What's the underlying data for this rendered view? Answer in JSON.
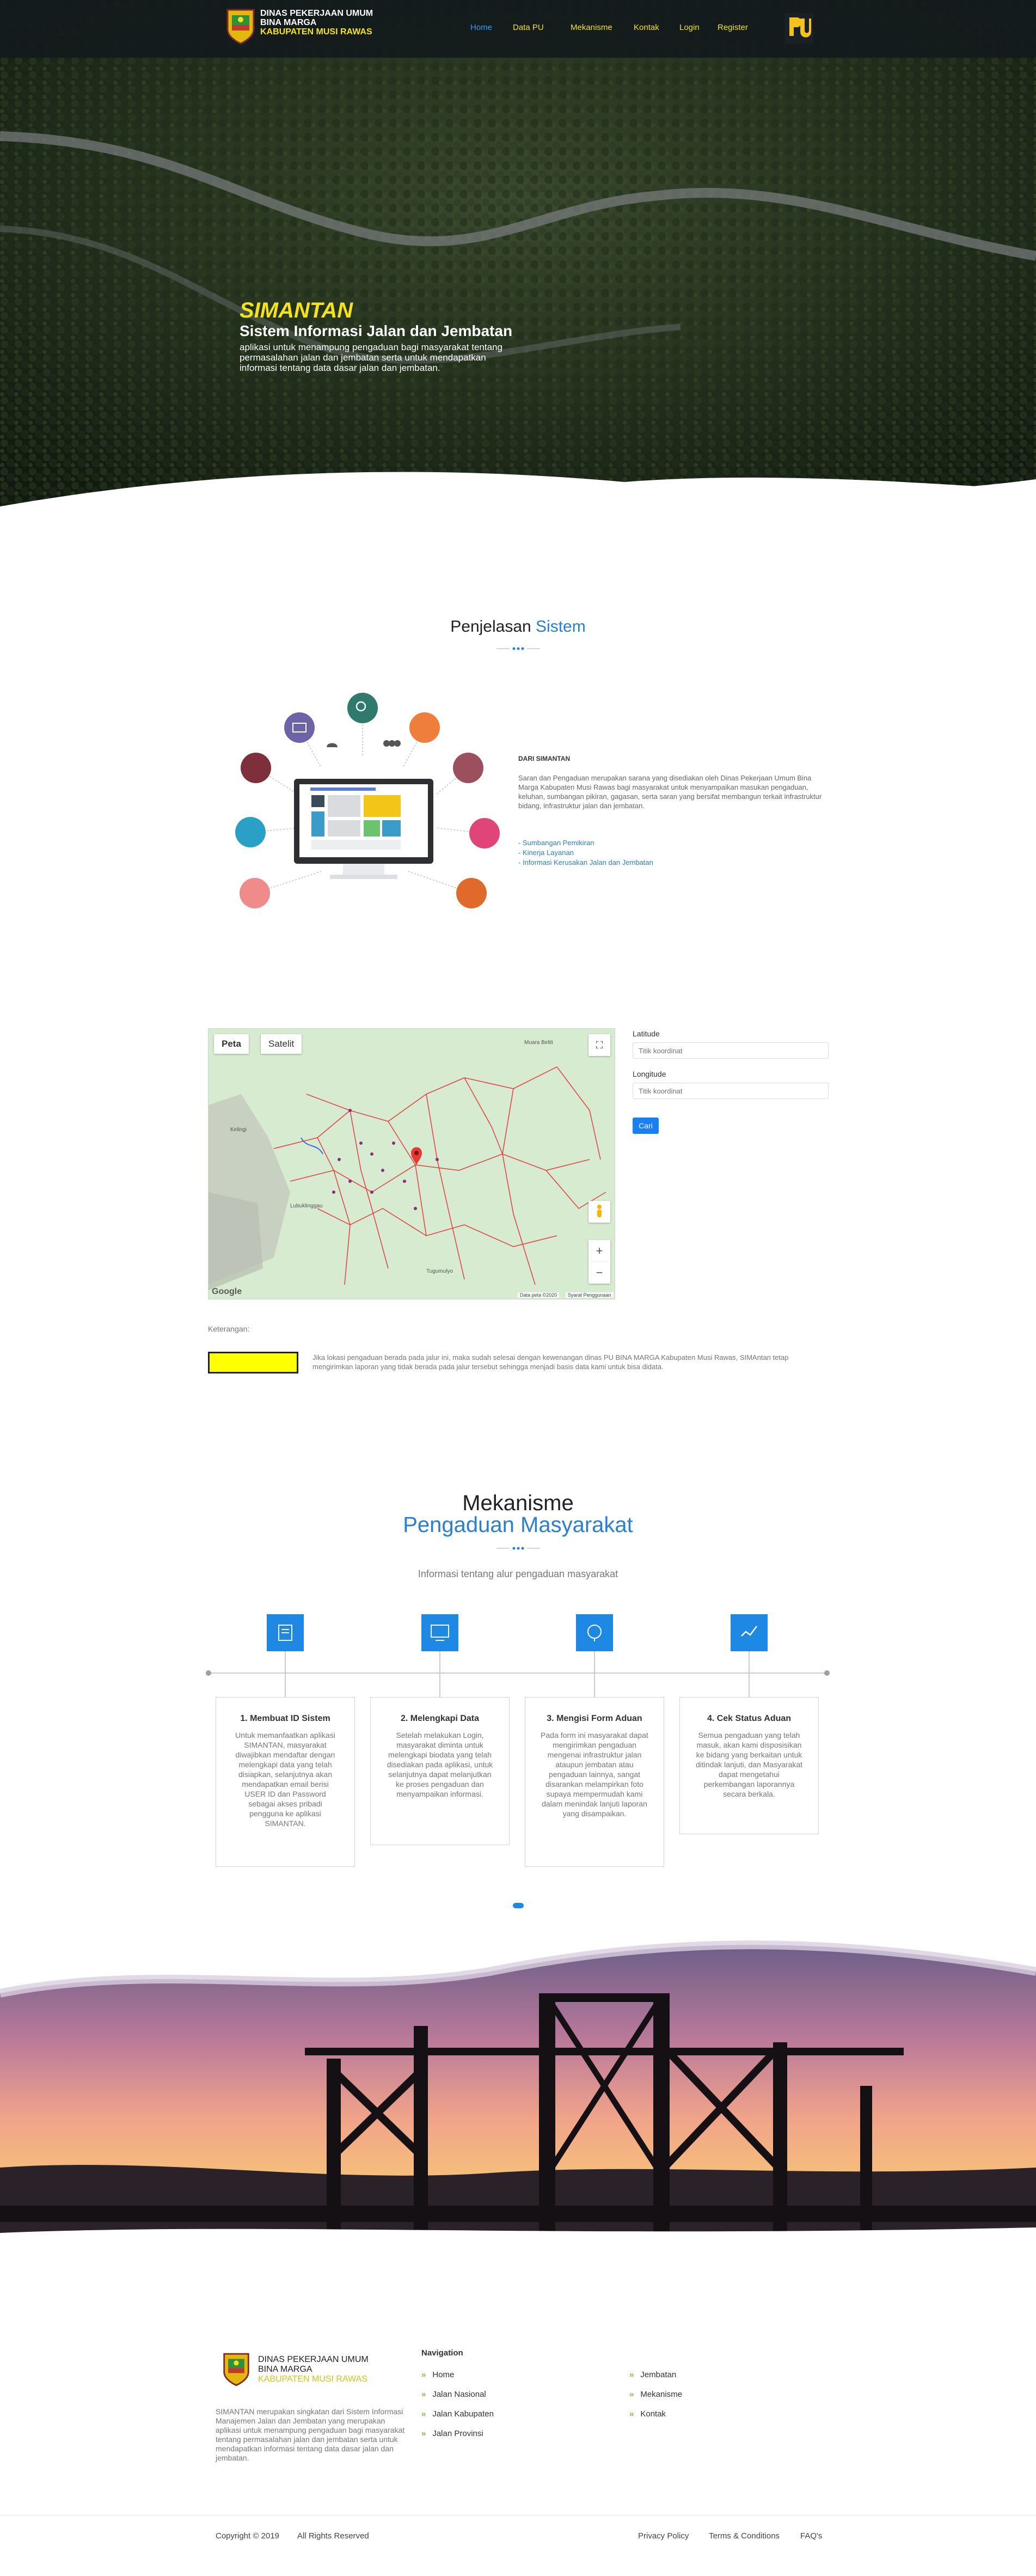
{
  "header": {
    "org_line1": "DINAS PEKERJAAN UMUM",
    "org_line2": "BINA MARGA",
    "org_line3": "KABUPATEN MUSI RAWAS",
    "nav": [
      "Home",
      "Data PU",
      "Mekanisme",
      "Kontak",
      "Login",
      "Register"
    ],
    "active_nav": "Home"
  },
  "hero": {
    "title": "SIMANTAN",
    "subtitle": "Sistem Informasi Jalan dan Jembatan",
    "description": "aplikasi untuk menampung pengaduan bagi masyarakat tentang permasalahan jalan dan jembatan serta untuk mendapatkan informasi tentang data dasar jalan dan jembatan."
  },
  "penjelasan": {
    "title_plain": "Penjelasan",
    "title_accent": "Sistem",
    "heading": "DARI SIMANTAN",
    "body": "Saran dan Pengaduan merupakan sarana yang disediakan oleh Dinas Pekerjaan Umum Bina Marga Kabupaten Musi Rawas bagi masyarakat untuk menyampaikan masukan pengaduan, keluhan, sumbangan pikiran, gagasan, serta saran yang bersifat membangun terkait infrastruktur bidang, infrastruktur jalan dan jembatan.",
    "links": [
      "- Sumbangan Pemikiran",
      "- Kinerja Layanan",
      "- Informasi Kerusakan Jalan dan Jembatan"
    ]
  },
  "map": {
    "tabs": [
      "Peta",
      "Satelit"
    ],
    "active_tab": "Peta",
    "footer_note": "Data peta ©2020",
    "terms": "Syarat Penggunaan",
    "brand": "Google",
    "places": [
      "Muara Beliti",
      "Lubuklinggau",
      "Tugumulyo",
      "Kelingi"
    ]
  },
  "form": {
    "lat_label": "Latitude",
    "lat_placeholder": "Titik koordinat",
    "lng_label": "Longitude",
    "lng_placeholder": "Titik koordinat",
    "button": "Cari"
  },
  "legend": {
    "label": "Keterangan:",
    "text": "Jika lokasi pengaduan berada pada jalur ini, maka sudah selesai dengan kewenangan dinas PU BINA MARGA Kabupaten Musi Rawas, SIMAntan tetap mengirimkan laporan yang tidak berada pada jalur tersebut sehingga menjadi basis data kami untuk bisa didata.",
    "color": "#ffff00"
  },
  "mekanisme": {
    "title": "Mekanisme",
    "title2": "Pengaduan Masyarakat",
    "subtitle": "Informasi tentang alur pengaduan masyarakat",
    "steps": [
      {
        "title": "1. Membuat ID Sistem",
        "text": "Untuk memanfaatkan aplikasi SIMANTAN, masyarakat diwajibkan mendaftar dengan melengkapi data yang telah disiapkan, selanjutnya akan mendapatkan email berisi USER ID dan Password sebagai akses pribadi pengguna ke aplikasi SIMANTAN."
      },
      {
        "title": "2. Melengkapi Data",
        "text": "Setelah melakukan Login, masyarakat diminta untuk melengkapi biodata yang telah disediakan pada aplikasi, untuk selanjutnya dapat melanjutkan ke proses pengaduan dan menyampaikan informasi."
      },
      {
        "title": "3. Mengisi Form Aduan",
        "text": "Pada form ini masyarakat dapat mengirimkan pengaduan mengenai infrastruktur jalan ataupun jembatan atau pengaduan lainnya, sangat disarankan melampirkan foto supaya mempermudah kami dalam menindak lanjuti laporan yang disampaikan."
      },
      {
        "title": "4. Cek Status Aduan",
        "text": "Semua pengaduan yang telah masuk, akan kami disposisikan ke bidang yang berkaitan untuk ditindak lanjuti, dan Masyarakat dapat mengetahui perkembangan laporannya secara berkala."
      }
    ]
  },
  "footer": {
    "org_line1": "DINAS PEKERJAAN UMUM",
    "org_line2": "BINA MARGA",
    "org_line3": "KABUPATEN MUSI RAWAS",
    "about": "SIMANTAN merupakan singkatan dari Sistem Informasi Manajemen Jalan dan Jembatan yang merupakan aplikasi untuk menampung pengaduan bagi masyarakat tentang permasalahan jalan dan jembatan serta untuk mendapatkan informasi tentang data dasar jalan dan jembatan.",
    "nav_title": "Navigation",
    "links_col1": [
      "Home",
      "Jalan Nasional",
      "Jalan Kabupaten",
      "Jalan Provinsi"
    ],
    "links_col2": [
      "Jembatan",
      "Mekanisme",
      "Kontak"
    ],
    "copyright": "Copyright © 2019",
    "rights": "All Rights Reserved",
    "bottom_links": [
      "Privacy Policy",
      "Terms & Conditions",
      "FAQ's"
    ]
  },
  "colors": {
    "accent": "#2b7fd1",
    "brand_yellow": "#f3e21c",
    "button": "#1a7ff0",
    "step_icon": "#1e88e5"
  }
}
